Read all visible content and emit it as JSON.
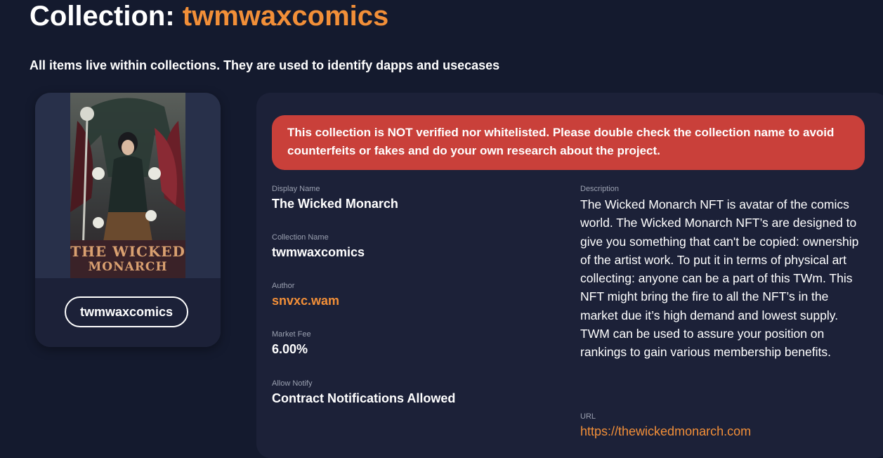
{
  "header": {
    "title_prefix": "Collection:",
    "title_name": "twmwaxcomics",
    "subtitle": "All items live within collections. They are used to identify dapps and usecases"
  },
  "card": {
    "image_title_line1": "THE WICKED",
    "image_title_line2": "MONARCH",
    "collection_pill": "twmwaxcomics"
  },
  "panel": {
    "warning": "This collection is NOT verified nor whitelisted. Please double check the collection name to avoid counterfeits or fakes and do your own research about the project.",
    "fields": {
      "display_name": {
        "label": "Display Name",
        "value": "The Wicked Monarch"
      },
      "collection_name": {
        "label": "Collection Name",
        "value": "twmwaxcomics"
      },
      "author": {
        "label": "Author",
        "value": "snvxc.wam"
      },
      "market_fee": {
        "label": "Market Fee",
        "value": "6.00%"
      },
      "allow_notify": {
        "label": "Allow Notify",
        "value": "Contract Notifications Allowed"
      },
      "description": {
        "label": "Description",
        "value": "The Wicked Monarch NFT is avatar of the comics world. The Wicked Monarch NFT’s are designed to give you something that can't be copied: ownership of the artist work. To put it in terms of physical art collecting: anyone can be a part of this TWm. This NFT might bring the fire to all the NFT’s in the market due it’s high demand and lowest supply. TWM can be used to assure your position on rankings to gain various membership benefits."
      },
      "url": {
        "label": "URL",
        "value": "https://thewickedmonarch.com"
      }
    }
  },
  "colors": {
    "background": "#141a2e",
    "accent": "#f28f38",
    "warning": "#c9403a",
    "panel": "#1c2138"
  }
}
